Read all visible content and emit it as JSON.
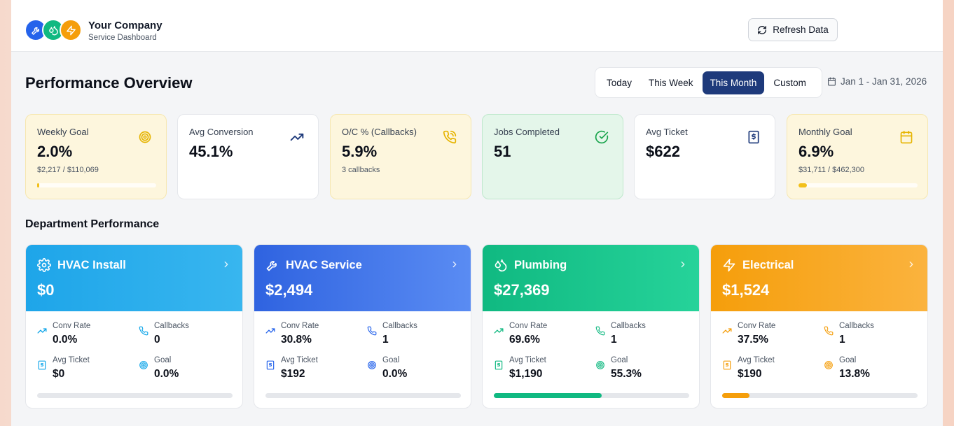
{
  "brand": {
    "name": "Your Company",
    "subtitle": "Service Dashboard",
    "logo_icons": [
      "wrench-icon",
      "droplets-icon",
      "zap-icon"
    ],
    "logo_colors": [
      "#2563eb",
      "#10b981",
      "#f59e0b"
    ]
  },
  "header": {
    "refresh_label": "Refresh Data",
    "refresh_icon": "refresh-icon"
  },
  "overview": {
    "title": "Performance Overview",
    "ranges": [
      "Today",
      "This Week",
      "This Month",
      "Custom"
    ],
    "active_range": "This Month",
    "date_range": "Jan 1 - Jan 31, 2026",
    "accent": "#1e3a7b"
  },
  "kpis": [
    {
      "label": "Weekly Goal",
      "value": "2.0%",
      "sub": "$2,217 / $110,069",
      "icon": "target-icon",
      "progress_pct": 2.0
    },
    {
      "label": "Avg Conversion",
      "value": "45.1%",
      "sub": "",
      "icon": "trending-up-icon"
    },
    {
      "label": "O/C % (Callbacks)",
      "value": "5.9%",
      "sub": "3 callbacks",
      "icon": "phone-icon"
    },
    {
      "label": "Jobs Completed",
      "value": "51",
      "sub": "",
      "icon": "check-circle-icon"
    },
    {
      "label": "Avg Ticket",
      "value": "$622",
      "sub": "",
      "icon": "receipt-icon"
    },
    {
      "label": "Monthly Goal",
      "value": "6.9%",
      "sub": "$31,711 / $462,300",
      "icon": "calendar-icon",
      "progress_pct": 6.9
    }
  ],
  "departments_title": "Department Performance",
  "departments": [
    {
      "name": "HVAC Install",
      "amount": "$0",
      "icon": "gear-icon",
      "gradient": [
        "#1ea5e9",
        "#38b6ef"
      ],
      "accent": "#0ea5e9",
      "metrics": {
        "conv_rate_label": "Conv Rate",
        "conv_rate": "0.0%",
        "callbacks_label": "Callbacks",
        "callbacks": "0",
        "avg_ticket_label": "Avg Ticket",
        "avg_ticket": "$0",
        "goal_label": "Goal",
        "goal": "0.0%"
      },
      "goal_progress": 0.0
    },
    {
      "name": "HVAC Service",
      "amount": "$2,494",
      "icon": "wrench-icon",
      "gradient": [
        "#2f63e0",
        "#5a8cf3"
      ],
      "accent": "#2563eb",
      "metrics": {
        "conv_rate_label": "Conv Rate",
        "conv_rate": "30.8%",
        "callbacks_label": "Callbacks",
        "callbacks": "1",
        "avg_ticket_label": "Avg Ticket",
        "avg_ticket": "$192",
        "goal_label": "Goal",
        "goal": "0.0%"
      },
      "goal_progress": 0.0
    },
    {
      "name": "Plumbing",
      "amount": "$27,369",
      "icon": "droplets-icon",
      "gradient": [
        "#10b981",
        "#26d39a"
      ],
      "accent": "#10b981",
      "metrics": {
        "conv_rate_label": "Conv Rate",
        "conv_rate": "69.6%",
        "callbacks_label": "Callbacks",
        "callbacks": "1",
        "avg_ticket_label": "Avg Ticket",
        "avg_ticket": "$1,190",
        "goal_label": "Goal",
        "goal": "55.3%"
      },
      "goal_progress": 55.3
    },
    {
      "name": "Electrical",
      "amount": "$1,524",
      "icon": "zap-icon",
      "gradient": [
        "#f59e0b",
        "#fbb33e"
      ],
      "accent": "#f59e0b",
      "metrics": {
        "conv_rate_label": "Conv Rate",
        "conv_rate": "37.5%",
        "callbacks_label": "Callbacks",
        "callbacks": "1",
        "avg_ticket_label": "Avg Ticket",
        "avg_ticket": "$190",
        "goal_label": "Goal",
        "goal": "13.8%"
      },
      "goal_progress": 13.8
    }
  ]
}
